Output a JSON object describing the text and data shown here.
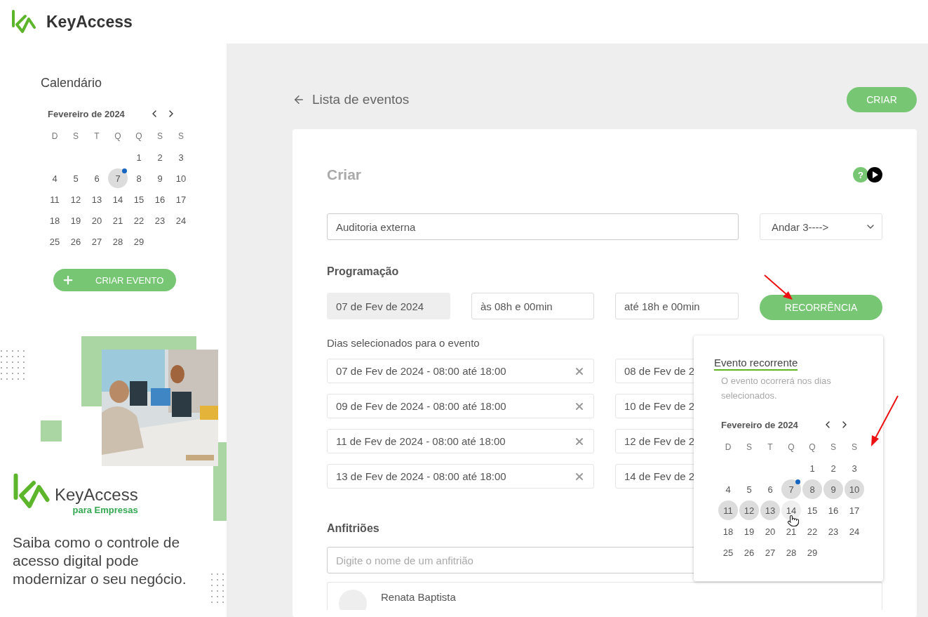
{
  "header": {
    "brand": "KeyAccess"
  },
  "sidebar": {
    "title": "Calendário",
    "calendar": {
      "month": "Fevereiro de 2024",
      "weekdays": [
        "D",
        "S",
        "T",
        "Q",
        "Q",
        "S",
        "S"
      ],
      "weeks": [
        [
          {
            "label": "1",
            "selected": false,
            "dot": false
          },
          {
            "label": "2",
            "selected": false,
            "dot": false
          },
          {
            "label": "3",
            "selected": false,
            "dot": false
          }
        ],
        [
          {
            "label": "4",
            "selected": false,
            "dot": false
          },
          {
            "label": "5",
            "selected": false,
            "dot": false
          },
          {
            "label": "6",
            "selected": false,
            "dot": false
          },
          {
            "label": "7",
            "selected": true,
            "dot": true
          },
          {
            "label": "8",
            "selected": false,
            "dot": false
          },
          {
            "label": "9",
            "selected": false,
            "dot": false
          },
          {
            "label": "10",
            "selected": false,
            "dot": false
          }
        ],
        [
          {
            "label": "11",
            "selected": false,
            "dot": false
          },
          {
            "label": "12",
            "selected": false,
            "dot": false
          },
          {
            "label": "13",
            "selected": false,
            "dot": false
          },
          {
            "label": "14",
            "selected": false,
            "dot": false
          },
          {
            "label": "15",
            "selected": false,
            "dot": false
          },
          {
            "label": "16",
            "selected": false,
            "dot": false
          },
          {
            "label": "17",
            "selected": false,
            "dot": false
          }
        ],
        [
          {
            "label": "18",
            "selected": false,
            "dot": false
          },
          {
            "label": "19",
            "selected": false,
            "dot": false
          },
          {
            "label": "20",
            "selected": false,
            "dot": false
          },
          {
            "label": "21",
            "selected": false,
            "dot": false
          },
          {
            "label": "22",
            "selected": false,
            "dot": false
          },
          {
            "label": "23",
            "selected": false,
            "dot": false
          },
          {
            "label": "24",
            "selected": false,
            "dot": false
          }
        ],
        [
          {
            "label": "25",
            "selected": false,
            "dot": false
          },
          {
            "label": "26",
            "selected": false,
            "dot": false
          },
          {
            "label": "27",
            "selected": false,
            "dot": false
          },
          {
            "label": "28",
            "selected": false,
            "dot": false
          },
          {
            "label": "29",
            "selected": false,
            "dot": false
          }
        ]
      ]
    },
    "create_button": "CRIAR EVENTO",
    "ad": {
      "kind": "picture",
      "brand": "KeyAccess",
      "subbrand": "para Empresas",
      "tagline": "Saiba como o controle de acesso digital pode modernizar o seu negócio."
    }
  },
  "main": {
    "back_link": "Lista de eventos",
    "create_button": "CRIAR",
    "form": {
      "title": "Criar",
      "help": "?",
      "name": {
        "value": "Auditoria externa"
      },
      "location": {
        "value": "Andar 3---->"
      },
      "schedule_heading": "Programação",
      "date": "07 de Fev de 2024",
      "start": "às 08h e 00min",
      "end": "até 18h e 00min",
      "recurrence_button": "RECORRÊNCIA",
      "days_heading": "Dias selecionados para o evento",
      "days": [
        [
          "07 de Fev de 2024 - 08:00 até 18:00",
          "08 de Fev de 2"
        ],
        [
          "09 de Fev de 2024 - 08:00 até 18:00",
          "10 de Fev de 2"
        ],
        [
          "11 de Fev de 2024 - 08:00 até 18:00",
          "12 de Fev de 2"
        ],
        [
          "13 de Fev de 2024 - 08:00 até 18:00",
          "14 de Fev de 2"
        ]
      ],
      "hosts_heading": "Anfitriões",
      "hosts_field": {
        "placeholder": "Digite o nome de um anfitrião"
      },
      "hosts": [
        {
          "name": "Renata Baptista"
        }
      ]
    },
    "recurrence_popover": {
      "title": "Evento recorrente",
      "description": "O evento ocorrerá nos dias selecionados.",
      "calendar": {
        "month": "Fevereiro de 2024",
        "weekdays": [
          "D",
          "S",
          "T",
          "Q",
          "Q",
          "S",
          "S"
        ],
        "weeks": [
          [
            {
              "label": "1",
              "selected": false,
              "hovered": false,
              "dot": false
            },
            {
              "label": "2",
              "selected": false,
              "hovered": false,
              "dot": false
            },
            {
              "label": "3",
              "selected": false,
              "hovered": false,
              "dot": false
            }
          ],
          [
            {
              "label": "4",
              "selected": false,
              "hovered": false,
              "dot": false
            },
            {
              "label": "5",
              "selected": false,
              "hovered": false,
              "dot": false
            },
            {
              "label": "6",
              "selected": false,
              "hovered": false,
              "dot": false
            },
            {
              "label": "7",
              "selected": true,
              "hovered": false,
              "dot": true
            },
            {
              "label": "8",
              "selected": true,
              "hovered": false,
              "dot": false
            },
            {
              "label": "9",
              "selected": true,
              "hovered": false,
              "dot": false
            },
            {
              "label": "10",
              "selected": true,
              "hovered": false,
              "dot": false
            }
          ],
          [
            {
              "label": "11",
              "selected": true,
              "hovered": false,
              "dot": false
            },
            {
              "label": "12",
              "selected": true,
              "hovered": false,
              "dot": false
            },
            {
              "label": "13",
              "selected": true,
              "hovered": false,
              "dot": false
            },
            {
              "label": "14",
              "selected": false,
              "hovered": true,
              "dot": false
            },
            {
              "label": "15",
              "selected": false,
              "hovered": false,
              "dot": false
            },
            {
              "label": "16",
              "selected": false,
              "hovered": false,
              "dot": false
            },
            {
              "label": "17",
              "selected": false,
              "hovered": false,
              "dot": false
            }
          ],
          [
            {
              "label": "18",
              "selected": false,
              "hovered": false,
              "dot": false
            },
            {
              "label": "19",
              "selected": false,
              "hovered": false,
              "dot": false
            },
            {
              "label": "20",
              "selected": false,
              "hovered": false,
              "dot": false
            },
            {
              "label": "21",
              "selected": false,
              "hovered": false,
              "dot": false
            },
            {
              "label": "22",
              "selected": false,
              "hovered": false,
              "dot": false
            },
            {
              "label": "23",
              "selected": false,
              "hovered": false,
              "dot": false
            },
            {
              "label": "24",
              "selected": false,
              "hovered": false,
              "dot": false
            }
          ],
          [
            {
              "label": "25",
              "selected": false,
              "hovered": false,
              "dot": false
            },
            {
              "label": "26",
              "selected": false,
              "hovered": false,
              "dot": false
            },
            {
              "label": "27",
              "selected": false,
              "hovered": false,
              "dot": false
            },
            {
              "label": "28",
              "selected": false,
              "hovered": false,
              "dot": false
            },
            {
              "label": "29",
              "selected": false,
              "hovered": false,
              "dot": false
            }
          ]
        ]
      }
    }
  }
}
